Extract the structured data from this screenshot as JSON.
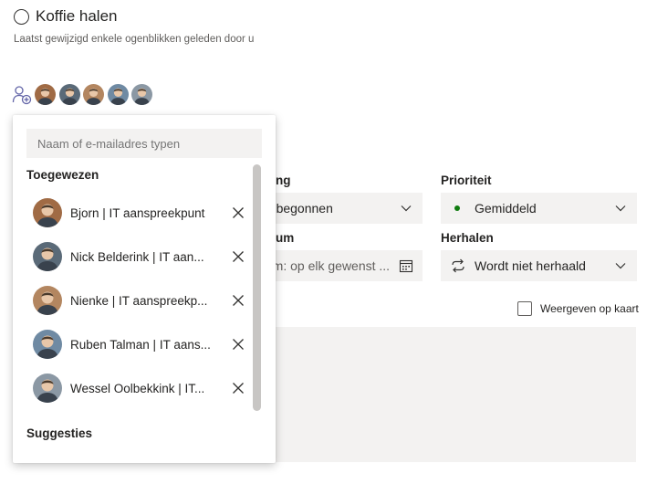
{
  "task": {
    "title": "Koffie halen",
    "subtitle": "Laatst gewijzigd enkele ogenblikken geleden door u"
  },
  "assign": {
    "icon": "add-person-icon",
    "avatars": [
      {
        "name": "Bjorn",
        "color": "#a06b45"
      },
      {
        "name": "Nick",
        "color": "#5a6a78"
      },
      {
        "name": "Nienke",
        "color": "#b38660"
      },
      {
        "name": "Ruben",
        "color": "#6f8aa3"
      },
      {
        "name": "Wessel",
        "color": "#8b98a4"
      }
    ]
  },
  "popup": {
    "search_placeholder": "Naam of e-mailadres typen",
    "assigned_title": "Toegewezen",
    "suggestions_title": "Suggesties",
    "assigned": [
      {
        "name": "Bjorn | IT aanspreekpunt"
      },
      {
        "name": "Nick Belderink | IT aan..."
      },
      {
        "name": "Nienke | IT aanspreekp..."
      },
      {
        "name": "Ruben Talman | IT aans..."
      },
      {
        "name": "Wessel Oolbekkink | IT..."
      }
    ]
  },
  "form": {
    "voortgang_label_tail": "ng",
    "voortgang_value": "et begonnen",
    "prioriteit_label": "Prioriteit",
    "prioriteit_value": "Gemiddeld",
    "datum_label_tail": "um",
    "datum_value": "tum: op elk gewenst ...",
    "herhalen_label": "Herhalen",
    "herhalen_value": "Wordt niet herhaald",
    "map_label": "Weergeven op kaart"
  },
  "colors": {
    "priority_dot": "#107c10",
    "accent": "#6264a7",
    "field_bg": "#f3f2f1"
  }
}
